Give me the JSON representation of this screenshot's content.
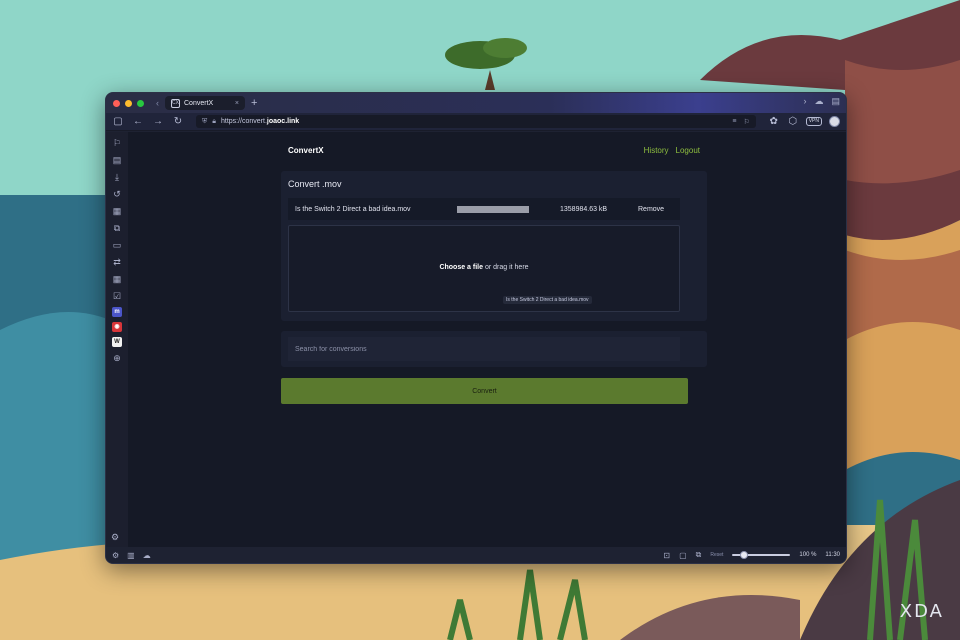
{
  "browser": {
    "tab_title": "ConvertX",
    "tab_favicon": "CX",
    "url_prefix": "https://convert.",
    "url_domain": "joaoc.link",
    "vpn_label": "VPN"
  },
  "app": {
    "brand": "ConvertX",
    "nav": {
      "history": "History",
      "logout": "Logout"
    },
    "card_title": "Convert .mov",
    "file": {
      "name": "Is the Switch 2 Direct a bad idea.mov",
      "size": "1358984.63 kB",
      "remove_label": "Remove",
      "progress": 1.0
    },
    "dropzone": {
      "choose_label": "Choose a file",
      "drag_label": " or drag it here",
      "tooltip": "Is the Switch 2 Direct a bad idea.mov"
    },
    "search_placeholder": "Search for conversions",
    "convert_label": "Convert",
    "accent_color": "#8ebe3f",
    "button_color": "#5b7a2e"
  },
  "statusbar": {
    "reset_label": "Reset",
    "zoom": "100 %",
    "zoom_fraction": 1.0,
    "clock": "11:30"
  },
  "watermark": "XDA"
}
